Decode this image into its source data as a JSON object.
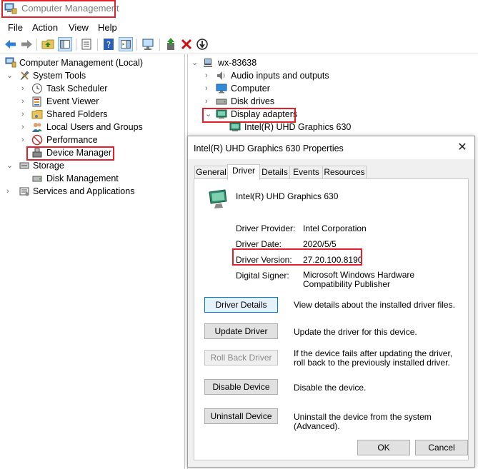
{
  "window": {
    "title": "Computer Management"
  },
  "menu": [
    "File",
    "Action",
    "View",
    "Help"
  ],
  "left_tree": {
    "root": "Computer Management (Local)",
    "system_tools": "System Tools",
    "items": [
      "Task Scheduler",
      "Event Viewer",
      "Shared Folders",
      "Local Users and Groups",
      "Performance",
      "Device Manager"
    ],
    "storage": "Storage",
    "disk_management": "Disk Management",
    "services": "Services and Applications"
  },
  "right_tree": {
    "root": "wx-83638",
    "items": [
      "Audio inputs and outputs",
      "Computer",
      "Disk drives",
      "Display adapters"
    ],
    "adapter": "Intel(R) UHD Graphics 630"
  },
  "dialog": {
    "title": "Intel(R) UHD Graphics 630 Properties",
    "tabs": [
      "General",
      "Driver",
      "Details",
      "Events",
      "Resources"
    ],
    "active_tab": "Driver",
    "device_name": "Intel(R) UHD Graphics 630",
    "props": {
      "provider_label": "Driver Provider:",
      "provider_value": "Intel Corporation",
      "date_label": "Driver Date:",
      "date_value": "2020/5/5",
      "version_label": "Driver Version:",
      "version_value": "27.20.100.8190",
      "signer_label": "Digital Signer:",
      "signer_value": "Microsoft Windows Hardware Compatibility Publisher"
    },
    "buttons": {
      "details": "Driver Details",
      "details_desc": "View details about the installed driver files.",
      "update": "Update Driver",
      "update_desc": "Update the driver for this device.",
      "rollback": "Roll Back Driver",
      "rollback_desc": "If the device fails after updating the driver, roll back to the previously installed driver.",
      "disable": "Disable Device",
      "disable_desc": "Disable the device.",
      "uninstall": "Uninstall Device",
      "uninstall_desc": "Uninstall the device from the system (Advanced).",
      "ok": "OK",
      "cancel": "Cancel"
    }
  },
  "colors": {
    "highlight": "#e0202a",
    "accent": "#0078d7"
  }
}
